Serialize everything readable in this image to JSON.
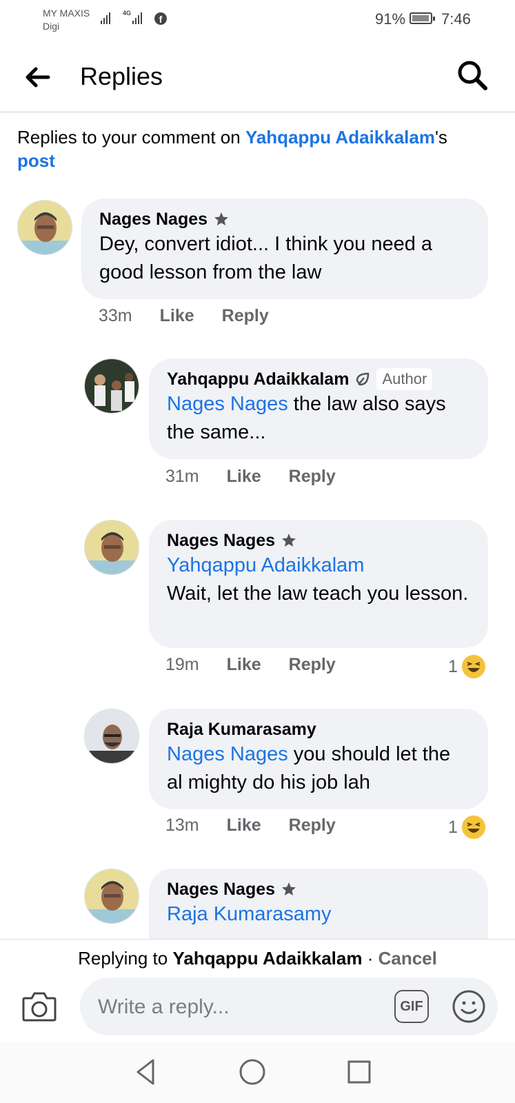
{
  "status_bar": {
    "carrier_1": "MY MAXIS",
    "carrier_2": "Digi",
    "network": "4G",
    "battery": "91%",
    "time": "7:46"
  },
  "app_bar": {
    "title": "Replies",
    "back_icon": "arrow-left-icon",
    "search_icon": "search-icon"
  },
  "header": {
    "prefix": "Replies to your comment on ",
    "post_owner": "Yahqappu Adaikkalam",
    "possessive": "'s",
    "post_link": "post"
  },
  "comments": [
    {
      "author": "Nages Nages",
      "mention": "",
      "text": "Dey, convert idiot... I think you need a good lesson from the law",
      "time": "33m",
      "like": "Like",
      "reply": "Reply",
      "reactions": ""
    },
    {
      "author": "Yahqappu Adaikkalam",
      "tag": "Author",
      "mention": "Nages Nages",
      "text": " the law also says the same...",
      "time": "31m",
      "like": "Like",
      "reply": "Reply",
      "reactions": ""
    },
    {
      "author": "Nages Nages",
      "mention": "Yahqappu Adaikkalam",
      "text": "Wait, let the law teach you lesson.",
      "time": "19m",
      "like": "Like",
      "reply": "Reply",
      "reactions": "1"
    },
    {
      "author": "Raja Kumarasamy",
      "mention": "Nages Nages",
      "text": " you should let the al mighty do his job lah",
      "time": "13m",
      "like": "Like",
      "reply": "Reply",
      "reactions": "1"
    },
    {
      "author": "Nages Nages",
      "mention": "Raja Kumarasamy",
      "text": ""
    }
  ],
  "reply_bar": {
    "prefix": "Replying to ",
    "target": "Yahqappu Adaikkalam",
    "separator": " · ",
    "cancel": "Cancel"
  },
  "composer": {
    "placeholder": "Write a reply...",
    "gif_label": "GIF"
  },
  "colors": {
    "link": "#1b74e4",
    "bubble": "#f0f2f5",
    "secondary_text": "#65676b"
  }
}
